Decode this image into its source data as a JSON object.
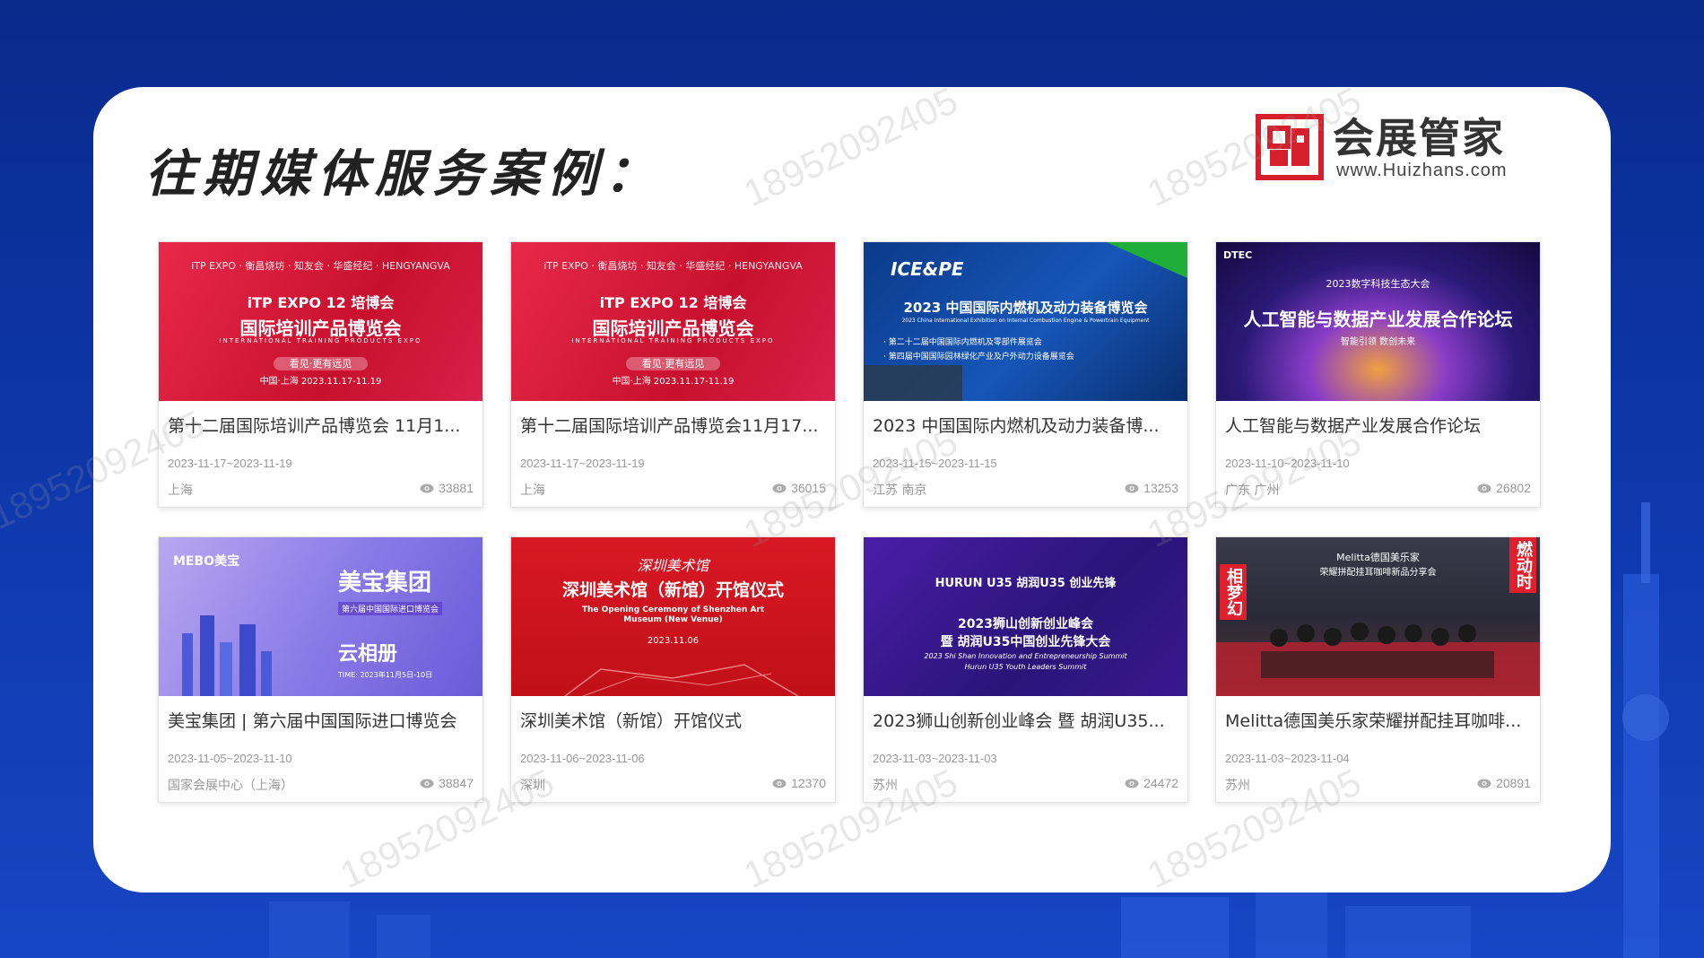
{
  "colors": {
    "page_bg": "#0d36a8",
    "panel_bg": "#ffffff",
    "brand_red": "#d61f2c",
    "text_dark": "#333333",
    "text_meta": "#999999"
  },
  "header": {
    "title": "往期媒体服务案例：",
    "logo_name": "会展管家",
    "logo_url": "www.Huizhans.com",
    "logo_icon": "huizhan-logo-icon"
  },
  "watermark_text": "18952092405",
  "cards": [
    {
      "title": "第十二届国际培训产品博览会 11月1...",
      "date": "2023-11-17~2023-11-19",
      "location": "上海",
      "views": "33881",
      "thumb": {
        "theme": "red",
        "line1": "iTP EXPO 12 培博会",
        "line2": "国际培训产品博览会",
        "line3": "INTERNATIONAL TRAINING PRODUCTS EXPO",
        "line4": "看见·更有远见",
        "line5": "中国·上海 2023.11.17-11.19"
      }
    },
    {
      "title": "第十二届国际培训产品博览会11月17...",
      "date": "2023-11-17~2023-11-19",
      "location": "上海",
      "views": "36015",
      "thumb": {
        "theme": "red",
        "line1": "iTP EXPO 12 培博会",
        "line2": "国际培训产品博览会",
        "line3": "INTERNATIONAL TRAINING PRODUCTS EXPO",
        "line4": "看见·更有远见",
        "line5": "中国·上海 2023.11.17-11.19"
      }
    },
    {
      "title": "2023 中国国际内燃机及动力装备博...",
      "date": "2023-11-15~2023-11-15",
      "location": "江苏 南京",
      "views": "13253",
      "thumb": {
        "theme": "blue-green",
        "line1": "ICE&PE",
        "line2": "2023 中国国际内燃机及动力装备博览会",
        "line3": "2023 China International Exhibition on Internal Combustion Engine & Powertrain Equipment",
        "line4": "· 第二十二届中国国际内燃机及零部件展览会",
        "line5": "· 第四届中国国际园林绿化产业及户外动力设备展览会"
      }
    },
    {
      "title": "人工智能与数据产业发展合作论坛",
      "date": "2023-11-10~2023-11-10",
      "location": "广东 广州",
      "views": "26802",
      "thumb": {
        "theme": "purple",
        "line1": "DTEC",
        "line2": "2023数字科技生态大会",
        "line3": "人工智能与数据产业发展合作论坛",
        "line4": "智能引领 数创未来",
        "line5": ""
      }
    },
    {
      "title": "美宝集团 | 第六届中国国际进口博览会",
      "date": "2023-11-05~2023-11-10",
      "location": "国家会展中心（上海）",
      "views": "38847",
      "thumb": {
        "theme": "lavender",
        "line1": "MEBO美宝",
        "line2": "美宝集团",
        "line3": "第六届中国国际进口博览会",
        "line4": "云相册",
        "line5": "TIME: 2023年11月5日-10日"
      }
    },
    {
      "title": "深圳美术馆（新馆）开馆仪式",
      "date": "2023-11-06~2023-11-06",
      "location": "深圳",
      "views": "12370",
      "thumb": {
        "theme": "crimson",
        "line1": "深圳美术馆",
        "line2": "深圳美术馆（新馆）开馆仪式",
        "line3": "The Opening Ceremony of Shenzhen Art Museum (New Venue)",
        "line4": "2023.11.06",
        "line5": ""
      }
    },
    {
      "title": "2023狮山创新创业峰会 暨 胡润U35...",
      "date": "2023-11-03~2023-11-03",
      "location": "苏州",
      "views": "24472",
      "thumb": {
        "theme": "indigo",
        "line1": "HURUN  U35  胡润U35 创业先锋",
        "line2": "2023狮山创新创业峰会",
        "line3": "暨 胡润U35中国创业先锋大会",
        "line4": "2023 Shi Shan Innovation and Entrepreneurship Summit",
        "line5": "Hurun U35 Youth Leaders Summit"
      }
    },
    {
      "title": "Melitta德国美乐家荣耀拼配挂耳咖啡...",
      "date": "2023-11-03~2023-11-04",
      "location": "苏州",
      "views": "20891",
      "thumb": {
        "theme": "photo",
        "line1": "Melitta德国美乐家",
        "line2": "荣耀拼配挂耳咖啡新品分享会",
        "line3": "相梦幻",
        "line4": "燃动时",
        "line5": ""
      }
    }
  ]
}
